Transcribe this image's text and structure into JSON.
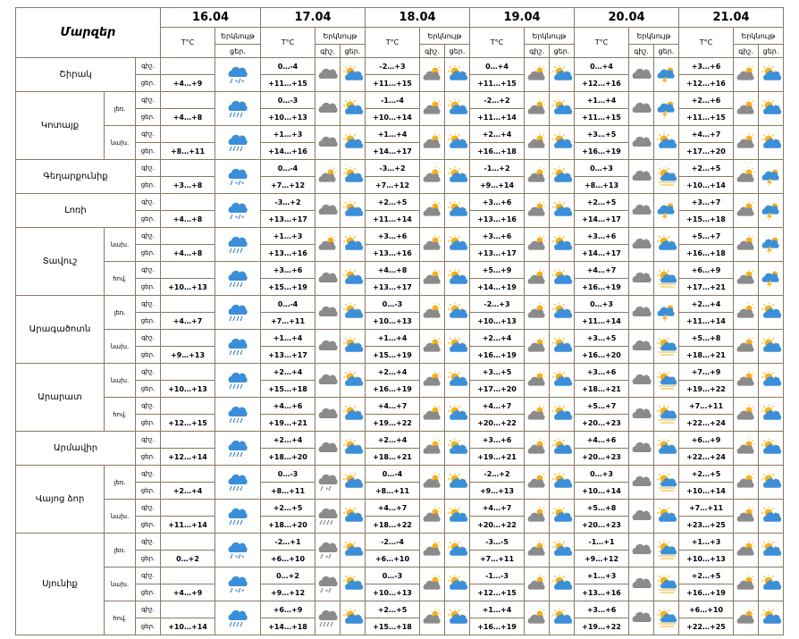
{
  "header": {
    "region_col": "Մարզեր",
    "dates": [
      "16.04",
      "17.04",
      "18.04",
      "19.04",
      "20.04",
      "21.04"
    ],
    "temp_label": "T°C",
    "cloud_label": "Երկնույթ",
    "night_short": "գիշ.",
    "day_short": "ցեր."
  },
  "regions": [
    {
      "name": "Շիրակ",
      "groups": [
        {
          "sub": "",
          "night": {
            "d1": "",
            "d2": "0…-4",
            "d3": "-2…+3",
            "d4": "0…+4",
            "d5": "0…+4",
            "d6": "+3…+6",
            "i1": "rain-snow",
            "i2": "cloud-grey",
            "i3": "sun-cloud-grey",
            "i4": "sun-cloud-grey",
            "i5": "cloud-grey",
            "i6": "sun-cloud-grey"
          },
          "day": {
            "d1": "+4…+9",
            "d2": "+11…+15",
            "d3": "+11…+15",
            "d4": "+11…+15",
            "d5": "+12…+16",
            "d6": "+12…+16",
            "i2": "sun-cloud",
            "i3": "sun-cloud",
            "i4": "sun-cloud",
            "i5": "thunder-sun",
            "i6": "sun-cloud"
          }
        }
      ]
    },
    {
      "name": "Կոտայք",
      "groups": [
        {
          "sub": "լեռ.",
          "night": {
            "d1": "",
            "d2": "0…-3",
            "d3": "-1…-4",
            "d4": "-2…+2",
            "d5": "+1…+4",
            "d6": "+2…+6",
            "i1": "rain",
            "i2": "cloud-grey",
            "i3": "sun-cloud-grey",
            "i4": "sun-cloud-grey",
            "i5": "cloud-grey",
            "i6": "sun-cloud-grey"
          },
          "day": {
            "d1": "+4…+8",
            "d2": "+10…+13",
            "d3": "+10…+14",
            "d4": "+11…+14",
            "d5": "+11…+15",
            "d6": "+11…+15",
            "i2": "sun-cloud",
            "i3": "sun-cloud",
            "i4": "sun-cloud",
            "i5": "thunder-sun",
            "i6": "sun-cloud"
          }
        },
        {
          "sub": "նախ.",
          "night": {
            "d1": "",
            "d2": "+1…+3",
            "d3": "+1…+4",
            "d4": "+2…+4",
            "d5": "+3…+5",
            "d6": "+4…+7",
            "i1": "rain",
            "i2": "cloud-grey",
            "i3": "sun-cloud-grey",
            "i4": "sun-cloud-grey",
            "i5": "cloud-grey",
            "i6": "sun-cloud-grey"
          },
          "day": {
            "d1": "+8…+11",
            "d2": "+14…+16",
            "d3": "+14…+17",
            "d4": "+16…+18",
            "d5": "+16…+19",
            "d6": "+17…+20",
            "i2": "sun-cloud",
            "i3": "sun-cloud",
            "i4": "sun-cloud",
            "i5": "sun-cloud",
            "i6": "sun-cloud"
          }
        }
      ]
    },
    {
      "name": "Գեղարքունիք",
      "groups": [
        {
          "sub": "",
          "night": {
            "d1": "",
            "d2": "0…-4",
            "d3": "-3…+2",
            "d4": "-1…+2",
            "d5": "0…+3",
            "d6": "+2…+5",
            "i1": "rain-snow",
            "i2": "sun-cloud-grey",
            "i3": "sun-cloud-grey",
            "i4": "sun-cloud-grey",
            "i5": "cloud-grey",
            "i6": "sun-cloud-grey"
          },
          "day": {
            "d1": "+3…+8",
            "d2": "+7…+12",
            "d3": "+7…+12",
            "d4": "+9…+14",
            "d5": "+8…+13",
            "d6": "+10…+14",
            "i2": "sun-cloud",
            "i3": "sun-cloud",
            "i4": "sun-cloud",
            "i5": "sun-storm",
            "i6": "thunder-sun"
          }
        }
      ]
    },
    {
      "name": "Լոռի",
      "groups": [
        {
          "sub": "",
          "night": {
            "d1": "",
            "d2": "-3…+2",
            "d3": "+2…+5",
            "d4": "+3…+6",
            "d5": "+2…+5",
            "d6": "+3…+7",
            "i1": "rain-snow",
            "i2": "cloud-grey",
            "i3": "sun-cloud-grey",
            "i4": "sun-cloud-grey",
            "i5": "cloud-grey",
            "i6": "sun-cloud-grey"
          },
          "day": {
            "d1": "+4…+8",
            "d2": "+13…+17",
            "d3": "+11…+14",
            "d4": "+13…+16",
            "d5": "+14…+17",
            "d6": "+15…+18",
            "i2": "sun-cloud",
            "i3": "sun-cloud",
            "i4": "sun-cloud",
            "i5": "thunder-sun",
            "i6": "thunder-sun"
          }
        }
      ]
    },
    {
      "name": "Տավուշ",
      "groups": [
        {
          "sub": "նախ.",
          "night": {
            "d1": "",
            "d2": "+1…+3",
            "d3": "+3…+6",
            "d4": "+3…+6",
            "d5": "+3…+6",
            "d6": "+5…+7",
            "i1": "rain",
            "i2": "sun-cloud-grey",
            "i3": "sun-cloud-grey",
            "i4": "sun-cloud-grey",
            "i5": "cloud-grey",
            "i6": "sun-cloud-grey"
          },
          "day": {
            "d1": "+4…+8",
            "d2": "+13…+16",
            "d3": "+13…+16",
            "d4": "+13…+17",
            "d5": "+14…+17",
            "d6": "+16…+18",
            "i2": "sun-cloud",
            "i3": "sun-cloud",
            "i4": "sun-cloud",
            "i5": "sun-cloud",
            "i6": "thunder-sun"
          }
        },
        {
          "sub": "հով.",
          "night": {
            "d1": "",
            "d2": "+3…+6",
            "d3": "+4…+8",
            "d4": "+5…+9",
            "d5": "+4…+7",
            "d6": "+6…+9",
            "i1": "rain",
            "i2": "cloud-grey",
            "i3": "sun-cloud-grey",
            "i4": "sun-cloud-grey",
            "i5": "cloud-grey",
            "i6": "sun-cloud-grey"
          },
          "day": {
            "d1": "+10…+13",
            "d2": "+15…+19",
            "d3": "+13…+17",
            "d4": "+14…+19",
            "d5": "+16…+19",
            "d6": "+17…+21",
            "i2": "sun-cloud",
            "i3": "sun-cloud",
            "i4": "sun-cloud",
            "i5": "sun-storm",
            "i6": "thunder-sun"
          }
        }
      ]
    },
    {
      "name": "Արագածոտն",
      "groups": [
        {
          "sub": "լեռ.",
          "night": {
            "d1": "",
            "d2": "0…-4",
            "d3": "0…-3",
            "d4": "-2…+3",
            "d5": "0…+3",
            "d6": "+2…+4",
            "i1": "rain",
            "i2": "cloud-grey",
            "i3": "sun-cloud-grey",
            "i4": "sun-cloud-grey",
            "i5": "cloud-grey",
            "i6": "sun-cloud-grey"
          },
          "day": {
            "d1": "+4…+7",
            "d2": "+7…+11",
            "d3": "+10…+13",
            "d4": "+10…+13",
            "d5": "+11…+14",
            "d6": "+11…+14",
            "i2": "sun-cloud",
            "i3": "sun-cloud",
            "i4": "sun-cloud",
            "i5": "thunder-sun",
            "i6": "sun-cloud"
          }
        },
        {
          "sub": "նախ.",
          "night": {
            "d1": "",
            "d2": "+1…+4",
            "d3": "+1…+4",
            "d4": "+2…+4",
            "d5": "+3…+5",
            "d6": "+5…+8",
            "i1": "rain",
            "i2": "cloud-grey",
            "i3": "sun-cloud-grey",
            "i4": "sun-cloud-grey",
            "i5": "cloud-grey",
            "i6": "sun-cloud-grey"
          },
          "day": {
            "d1": "+9…+13",
            "d2": "+13…+17",
            "d3": "+15…+19",
            "d4": "+16…+19",
            "d5": "+16…+20",
            "d6": "+18…+21",
            "i2": "sun-cloud",
            "i3": "sun-cloud",
            "i4": "sun-cloud",
            "i5": "sun-storm",
            "i6": "sun-cloud"
          }
        }
      ]
    },
    {
      "name": "Արարատ",
      "groups": [
        {
          "sub": "նախ.",
          "night": {
            "d1": "",
            "d2": "+2…+4",
            "d3": "+2…+4",
            "d4": "+3…+5",
            "d5": "+3…+6",
            "d6": "+7…+9",
            "i1": "rain",
            "i2": "cloud-grey",
            "i3": "sun-cloud-grey",
            "i4": "sun-cloud-grey",
            "i5": "cloud-grey",
            "i6": "sun-cloud-grey"
          },
          "day": {
            "d1": "+10…+13",
            "d2": "+15…+18",
            "d3": "+16…+19",
            "d4": "+17…+20",
            "d5": "+18…+21",
            "d6": "+19…+22",
            "i2": "sun-cloud",
            "i3": "sun-cloud",
            "i4": "sun-cloud",
            "i5": "sun-storm",
            "i6": "sun-cloud"
          }
        },
        {
          "sub": "հով.",
          "night": {
            "d1": "",
            "d2": "+4…+6",
            "d3": "+4…+7",
            "d4": "+4…+7",
            "d5": "+5…+7",
            "d6": "+7…+11",
            "i1": "rain",
            "i2": "cloud-grey",
            "i3": "sun-cloud-grey",
            "i4": "sun-cloud-grey",
            "i5": "cloud-grey",
            "i6": "sun-cloud-grey"
          },
          "day": {
            "d1": "+12…+15",
            "d2": "+19…+21",
            "d3": "+19…+22",
            "d4": "+20…+22",
            "d5": "+20…+23",
            "d6": "+22…+24",
            "i2": "sun-cloud",
            "i3": "sun-cloud",
            "i4": "sun-cloud",
            "i5": "sun-storm",
            "i6": "sun-cloud"
          }
        }
      ]
    },
    {
      "name": "Արմավիր",
      "groups": [
        {
          "sub": "",
          "night": {
            "d1": "",
            "d2": "+2…+4",
            "d3": "+2…+4",
            "d4": "+3…+6",
            "d5": "+4…+6",
            "d6": "+6…+9",
            "i1": "rain",
            "i2": "cloud-grey",
            "i3": "sun-cloud-grey",
            "i4": "sun-cloud-grey",
            "i5": "cloud-grey",
            "i6": "sun-cloud-grey"
          },
          "day": {
            "d1": "+12…+14",
            "d2": "+18…+20",
            "d3": "+18…+21",
            "d4": "+19…+21",
            "d5": "+20…+23",
            "d6": "+22…+24",
            "i2": "sun-cloud",
            "i3": "sun-cloud",
            "i4": "sun-cloud",
            "i5": "sun-cloud",
            "i6": "sun-cloud"
          }
        }
      ]
    },
    {
      "name": "Վայոց ձոր",
      "groups": [
        {
          "sub": "լեռ.",
          "night": {
            "d1": "",
            "d2": "0…-3",
            "d3": "0…-4",
            "d4": "-2…+2",
            "d5": "0…+3",
            "d6": "+2…+5",
            "i1": "rain",
            "i2": "rain-snow-grey",
            "i3": "sun-cloud-grey",
            "i4": "sun-cloud-grey",
            "i5": "cloud-grey",
            "i6": "sun-cloud-grey"
          },
          "day": {
            "d1": "+2…+4",
            "d2": "+8…+11",
            "d3": "+8…+11",
            "d4": "+9…+13",
            "d5": "+10…+14",
            "d6": "+10…+14",
            "i2": "sun-cloud",
            "i3": "sun-cloud",
            "i4": "sun-cloud",
            "i5": "sun-storm",
            "i6": "sun-cloud"
          }
        },
        {
          "sub": "նախ.",
          "night": {
            "d1": "",
            "d2": "+2…+5",
            "d3": "+4…+7",
            "d4": "+4…+7",
            "d5": "+5…+8",
            "d6": "+7…+11",
            "i1": "rain",
            "i2": "rain-grey",
            "i3": "sun-cloud-grey",
            "i4": "sun-cloud-grey",
            "i5": "cloud-grey",
            "i6": "sun-cloud-grey"
          },
          "day": {
            "d1": "+11…+14",
            "d2": "+18…+20",
            "d3": "+18…+22",
            "d4": "+20…+22",
            "d5": "+20…+23",
            "d6": "+23…+25",
            "i2": "sun-cloud",
            "i3": "sun-cloud",
            "i4": "sun-cloud",
            "i5": "sun-cloud",
            "i6": "sun-cloud"
          }
        }
      ]
    },
    {
      "name": "Սյունիք",
      "groups": [
        {
          "sub": "լեռ.",
          "night": {
            "d1": "",
            "d2": "-2…+1",
            "d3": "-2…-4",
            "d4": "-3…-5",
            "d5": "-1…+1",
            "d6": "+1…+3",
            "i1": "rain-snow",
            "i2": "rain-snow-grey",
            "i3": "sun-cloud-grey",
            "i4": "sun-cloud-grey",
            "i5": "cloud-grey",
            "i6": "sun-cloud-grey"
          },
          "day": {
            "d1": "0…+2",
            "d2": "+6…+10",
            "d3": "+6…+10",
            "d4": "+7…+11",
            "d5": "+9…+12",
            "d6": "+10…+13",
            "i2": "sun-cloud",
            "i3": "sun-cloud",
            "i4": "sun-cloud",
            "i5": "sun-storm",
            "i6": "sun-cloud"
          }
        },
        {
          "sub": "նախ.",
          "night": {
            "d1": "",
            "d2": "0…+2",
            "d3": "0…-3",
            "d4": "-1…-3",
            "d5": "+1…+3",
            "d6": "+2…+5",
            "i1": "rain-snow",
            "i2": "rain-snow-grey",
            "i3": "sun-cloud-grey",
            "i4": "sun-cloud-grey",
            "i5": "cloud-grey",
            "i6": "sun-cloud-grey"
          },
          "day": {
            "d1": "+4…+9",
            "d2": "+9…+12",
            "d3": "+10…+13",
            "d4": "+12…+15",
            "d5": "+13…+16",
            "d6": "+16…+19",
            "i2": "sun-cloud",
            "i3": "sun-cloud",
            "i4": "sun-cloud",
            "i5": "sun-storm",
            "i6": "sun-cloud"
          }
        },
        {
          "sub": "հով.",
          "night": {
            "d1": "",
            "d2": "+6…+9",
            "d3": "+2…+5",
            "d4": "+1…+4",
            "d5": "+3…+6",
            "d6": "+6…+10",
            "i1": "rain",
            "i2": "rain-grey",
            "i3": "sun-cloud-grey",
            "i4": "sun-cloud-grey",
            "i5": "cloud-grey",
            "i6": "sun-cloud-grey"
          },
          "day": {
            "d1": "+10…+14",
            "d2": "+14…+18",
            "d3": "+15…+18",
            "d4": "+16…+19",
            "d5": "+19…+22",
            "d6": "+22…+25",
            "i2": "sun-cloud",
            "i3": "sun-cloud",
            "i4": "sun-cloud",
            "i5": "sun-storm",
            "i6": "sun-cloud"
          }
        }
      ]
    }
  ]
}
